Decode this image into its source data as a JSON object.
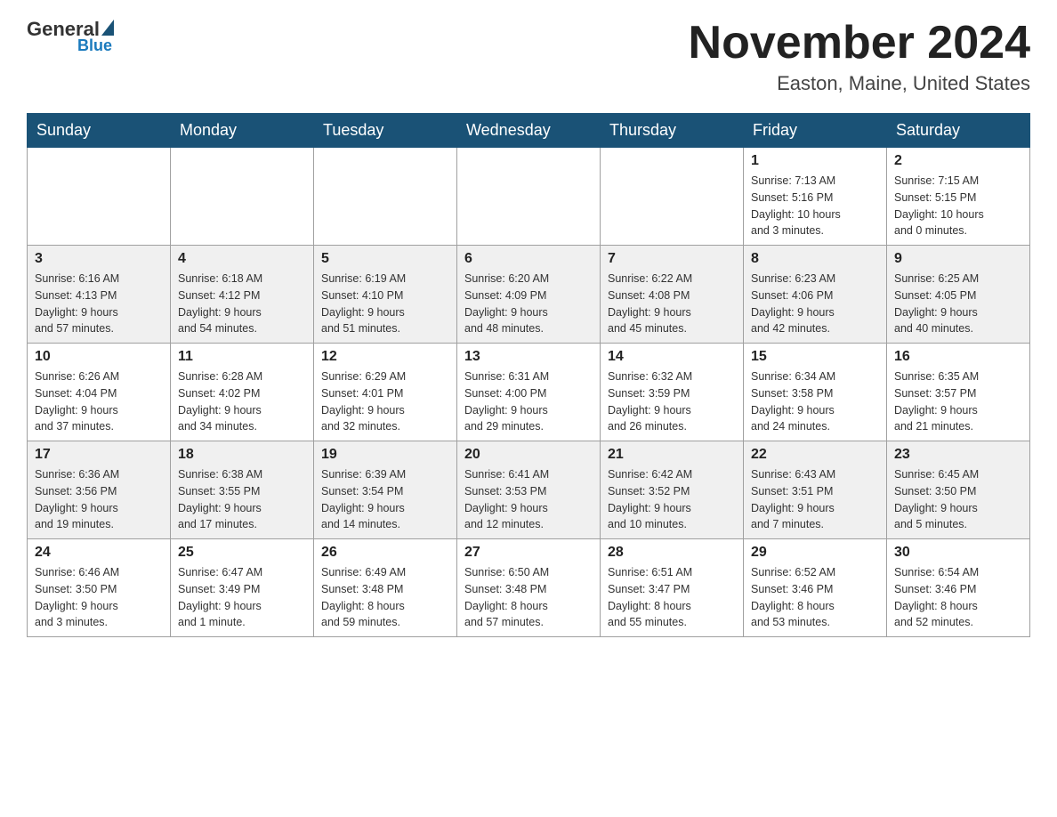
{
  "header": {
    "logo": {
      "general": "General",
      "blue": "Blue"
    },
    "title": "November 2024",
    "location": "Easton, Maine, United States"
  },
  "days_of_week": [
    "Sunday",
    "Monday",
    "Tuesday",
    "Wednesday",
    "Thursday",
    "Friday",
    "Saturday"
  ],
  "weeks": [
    {
      "id": "week1",
      "days": [
        {
          "num": "",
          "info": ""
        },
        {
          "num": "",
          "info": ""
        },
        {
          "num": "",
          "info": ""
        },
        {
          "num": "",
          "info": ""
        },
        {
          "num": "",
          "info": ""
        },
        {
          "num": "1",
          "info": "Sunrise: 7:13 AM\nSunset: 5:16 PM\nDaylight: 10 hours\nand 3 minutes."
        },
        {
          "num": "2",
          "info": "Sunrise: 7:15 AM\nSunset: 5:15 PM\nDaylight: 10 hours\nand 0 minutes."
        }
      ]
    },
    {
      "id": "week2",
      "days": [
        {
          "num": "3",
          "info": "Sunrise: 6:16 AM\nSunset: 4:13 PM\nDaylight: 9 hours\nand 57 minutes."
        },
        {
          "num": "4",
          "info": "Sunrise: 6:18 AM\nSunset: 4:12 PM\nDaylight: 9 hours\nand 54 minutes."
        },
        {
          "num": "5",
          "info": "Sunrise: 6:19 AM\nSunset: 4:10 PM\nDaylight: 9 hours\nand 51 minutes."
        },
        {
          "num": "6",
          "info": "Sunrise: 6:20 AM\nSunset: 4:09 PM\nDaylight: 9 hours\nand 48 minutes."
        },
        {
          "num": "7",
          "info": "Sunrise: 6:22 AM\nSunset: 4:08 PM\nDaylight: 9 hours\nand 45 minutes."
        },
        {
          "num": "8",
          "info": "Sunrise: 6:23 AM\nSunset: 4:06 PM\nDaylight: 9 hours\nand 42 minutes."
        },
        {
          "num": "9",
          "info": "Sunrise: 6:25 AM\nSunset: 4:05 PM\nDaylight: 9 hours\nand 40 minutes."
        }
      ]
    },
    {
      "id": "week3",
      "days": [
        {
          "num": "10",
          "info": "Sunrise: 6:26 AM\nSunset: 4:04 PM\nDaylight: 9 hours\nand 37 minutes."
        },
        {
          "num": "11",
          "info": "Sunrise: 6:28 AM\nSunset: 4:02 PM\nDaylight: 9 hours\nand 34 minutes."
        },
        {
          "num": "12",
          "info": "Sunrise: 6:29 AM\nSunset: 4:01 PM\nDaylight: 9 hours\nand 32 minutes."
        },
        {
          "num": "13",
          "info": "Sunrise: 6:31 AM\nSunset: 4:00 PM\nDaylight: 9 hours\nand 29 minutes."
        },
        {
          "num": "14",
          "info": "Sunrise: 6:32 AM\nSunset: 3:59 PM\nDaylight: 9 hours\nand 26 minutes."
        },
        {
          "num": "15",
          "info": "Sunrise: 6:34 AM\nSunset: 3:58 PM\nDaylight: 9 hours\nand 24 minutes."
        },
        {
          "num": "16",
          "info": "Sunrise: 6:35 AM\nSunset: 3:57 PM\nDaylight: 9 hours\nand 21 minutes."
        }
      ]
    },
    {
      "id": "week4",
      "days": [
        {
          "num": "17",
          "info": "Sunrise: 6:36 AM\nSunset: 3:56 PM\nDaylight: 9 hours\nand 19 minutes."
        },
        {
          "num": "18",
          "info": "Sunrise: 6:38 AM\nSunset: 3:55 PM\nDaylight: 9 hours\nand 17 minutes."
        },
        {
          "num": "19",
          "info": "Sunrise: 6:39 AM\nSunset: 3:54 PM\nDaylight: 9 hours\nand 14 minutes."
        },
        {
          "num": "20",
          "info": "Sunrise: 6:41 AM\nSunset: 3:53 PM\nDaylight: 9 hours\nand 12 minutes."
        },
        {
          "num": "21",
          "info": "Sunrise: 6:42 AM\nSunset: 3:52 PM\nDaylight: 9 hours\nand 10 minutes."
        },
        {
          "num": "22",
          "info": "Sunrise: 6:43 AM\nSunset: 3:51 PM\nDaylight: 9 hours\nand 7 minutes."
        },
        {
          "num": "23",
          "info": "Sunrise: 6:45 AM\nSunset: 3:50 PM\nDaylight: 9 hours\nand 5 minutes."
        }
      ]
    },
    {
      "id": "week5",
      "days": [
        {
          "num": "24",
          "info": "Sunrise: 6:46 AM\nSunset: 3:50 PM\nDaylight: 9 hours\nand 3 minutes."
        },
        {
          "num": "25",
          "info": "Sunrise: 6:47 AM\nSunset: 3:49 PM\nDaylight: 9 hours\nand 1 minute."
        },
        {
          "num": "26",
          "info": "Sunrise: 6:49 AM\nSunset: 3:48 PM\nDaylight: 8 hours\nand 59 minutes."
        },
        {
          "num": "27",
          "info": "Sunrise: 6:50 AM\nSunset: 3:48 PM\nDaylight: 8 hours\nand 57 minutes."
        },
        {
          "num": "28",
          "info": "Sunrise: 6:51 AM\nSunset: 3:47 PM\nDaylight: 8 hours\nand 55 minutes."
        },
        {
          "num": "29",
          "info": "Sunrise: 6:52 AM\nSunset: 3:46 PM\nDaylight: 8 hours\nand 53 minutes."
        },
        {
          "num": "30",
          "info": "Sunrise: 6:54 AM\nSunset: 3:46 PM\nDaylight: 8 hours\nand 52 minutes."
        }
      ]
    }
  ]
}
